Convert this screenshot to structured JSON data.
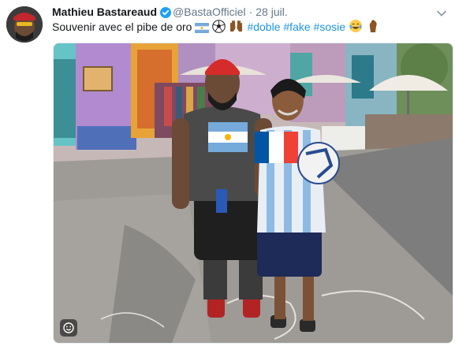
{
  "tweet": {
    "author_name": "Mathieu Bastareaud",
    "handle": "@BastaOfficiel",
    "separator": "·",
    "date": "28 juil.",
    "text_prefix": "Souvenir avec el pibe de oro",
    "hashtags": [
      "#doble",
      "#fake",
      "#sosie"
    ],
    "emoji_names": [
      "flag-argentina-icon",
      "soccer-ball-icon",
      "raised-hands-icon",
      "tears-of-joy-icon",
      "pinched-fingers-icon"
    ]
  },
  "colors": {
    "name": "#14171a",
    "meta": "#657786",
    "link": "#1b95e0",
    "verified": "#1da1f2",
    "argentina_blue": "#75aadb",
    "france_blue": "#0055a4",
    "france_red": "#ef4135",
    "red_cap": "#d62b2b"
  },
  "icons": {
    "verified": "verified-badge-icon",
    "more": "chevron-down-icon",
    "sticker": "smiley-sticker-icon"
  }
}
